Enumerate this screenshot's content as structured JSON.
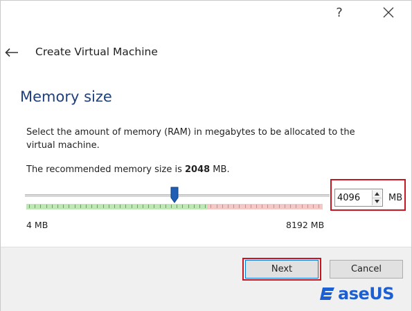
{
  "window": {
    "help_glyph": "?",
    "close_icon": "close-icon"
  },
  "header": {
    "back_icon": "back-arrow-icon",
    "title": "Create Virtual Machine"
  },
  "section": {
    "title": "Memory size",
    "description": "Select the amount of memory (RAM) in megabytes to be allocated to the virtual machine.",
    "recommended_prefix": "The recommended memory size is ",
    "recommended_value": "2048",
    "recommended_suffix": " MB."
  },
  "memory_slider": {
    "min": 4,
    "max": 8192,
    "value": 4096,
    "min_label": "4 MB",
    "max_label": "8192 MB",
    "green_until_fraction": 0.61,
    "colors": {
      "safe": "#bfe6b5",
      "warning": "#f3c9c7",
      "thumb": "#1e5fb4"
    }
  },
  "memory_input": {
    "value": "4096",
    "unit": "MB"
  },
  "buttons": {
    "next_label": "Next",
    "cancel_label": "Cancel"
  },
  "watermark": {
    "text": "aseUS",
    "logo_icon": "easeus-logo-icon",
    "color": "#1d5fd0"
  },
  "highlight_color": "#c8151f"
}
